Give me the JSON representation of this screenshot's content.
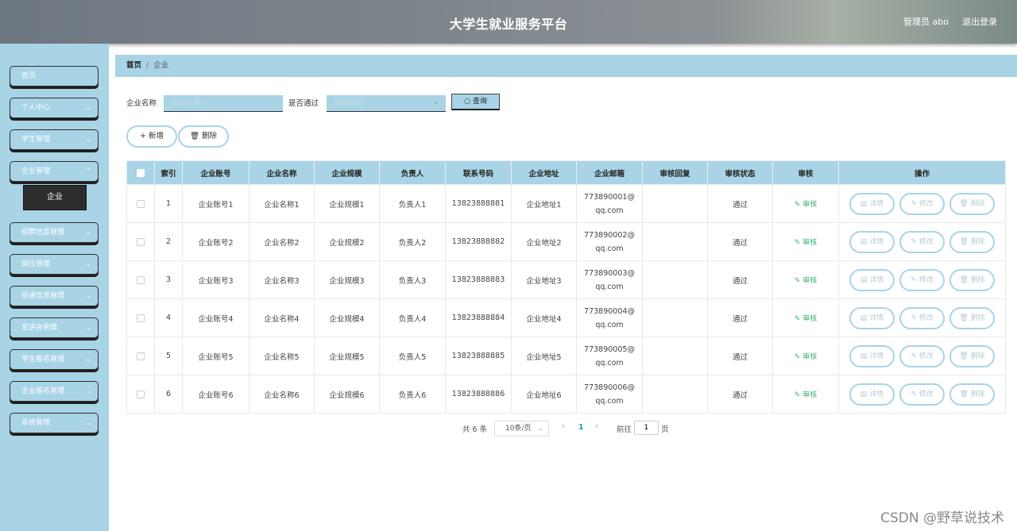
{
  "header": {
    "title": "大学生就业服务平台",
    "user": "管理员 abo",
    "logout": "退出登录"
  },
  "sidebar": {
    "items": [
      {
        "label": "首页",
        "has_arrow": false
      },
      {
        "label": "个人中心",
        "has_arrow": true
      },
      {
        "label": "学生管理",
        "has_arrow": true
      },
      {
        "label": "企业管理",
        "has_arrow": true
      },
      {
        "label": "招聘信息管理",
        "has_arrow": true
      },
      {
        "label": "岗位管理",
        "has_arrow": true
      },
      {
        "label": "投递信息管理",
        "has_arrow": true
      },
      {
        "label": "宣讲会管理",
        "has_arrow": true
      },
      {
        "label": "学生报名管理",
        "has_arrow": true
      },
      {
        "label": "企业报名管理",
        "has_arrow": true
      },
      {
        "label": "系统管理",
        "has_arrow": true
      }
    ],
    "submenu_active": "企业"
  },
  "breadcrumb": {
    "home": "首页",
    "separator": "/",
    "current": "企业"
  },
  "search": {
    "name_label": "企业名称",
    "name_placeholder": "企业名称",
    "pass_label": "是否通过",
    "pass_placeholder": "是否通过",
    "query_button": "查询"
  },
  "actions": {
    "add": "新增",
    "delete": "删除"
  },
  "table": {
    "headers": [
      "索引",
      "企业账号",
      "企业名称",
      "企业规模",
      "负责人",
      "联系号码",
      "企业地址",
      "企业邮箱",
      "审核回复",
      "审核状态",
      "审核",
      "操作"
    ],
    "audit_label": "审核",
    "op_labels": {
      "detail": "详情",
      "edit": "修改",
      "delete": "删除"
    },
    "rows": [
      {
        "index": "1",
        "account": "企业账号1",
        "name": "企业名称1",
        "scale": "企业规模1",
        "manager": "负责人1",
        "phone": "13823888881",
        "address": "企业地址1",
        "email_1": "773890001@",
        "email_2": "qq.com",
        "reply": "",
        "status": "通过"
      },
      {
        "index": "2",
        "account": "企业账号2",
        "name": "企业名称2",
        "scale": "企业规模2",
        "manager": "负责人2",
        "phone": "13823888882",
        "address": "企业地址2",
        "email_1": "773890002@",
        "email_2": "qq.com",
        "reply": "",
        "status": "通过"
      },
      {
        "index": "3",
        "account": "企业账号3",
        "name": "企业名称3",
        "scale": "企业规模3",
        "manager": "负责人3",
        "phone": "13823888883",
        "address": "企业地址3",
        "email_1": "773890003@",
        "email_2": "qq.com",
        "reply": "",
        "status": "通过"
      },
      {
        "index": "4",
        "account": "企业账号4",
        "name": "企业名称4",
        "scale": "企业规模4",
        "manager": "负责人4",
        "phone": "13823888884",
        "address": "企业地址4",
        "email_1": "773890004@",
        "email_2": "qq.com",
        "reply": "",
        "status": "通过"
      },
      {
        "index": "5",
        "account": "企业账号5",
        "name": "企业名称5",
        "scale": "企业规模5",
        "manager": "负责人5",
        "phone": "13823888885",
        "address": "企业地址5",
        "email_1": "773890005@",
        "email_2": "qq.com",
        "reply": "",
        "status": "通过"
      },
      {
        "index": "6",
        "account": "企业账号6",
        "name": "企业名称6",
        "scale": "企业规模6",
        "manager": "负责人6",
        "phone": "13823888886",
        "address": "企业地址6",
        "email_1": "773890006@",
        "email_2": "qq.com",
        "reply": "",
        "status": "通过"
      }
    ]
  },
  "pagination": {
    "total": "共 6 条",
    "page_size": "10条/页",
    "current_page": "1",
    "goto_label": "前往",
    "goto_value": "1",
    "page_unit": "页"
  },
  "watermark": "CSDN @野草说技术",
  "colors": {
    "accent": "#a8d4e6",
    "sidebar_active": "#2d2d2d",
    "audit_green": "#3cb371"
  }
}
